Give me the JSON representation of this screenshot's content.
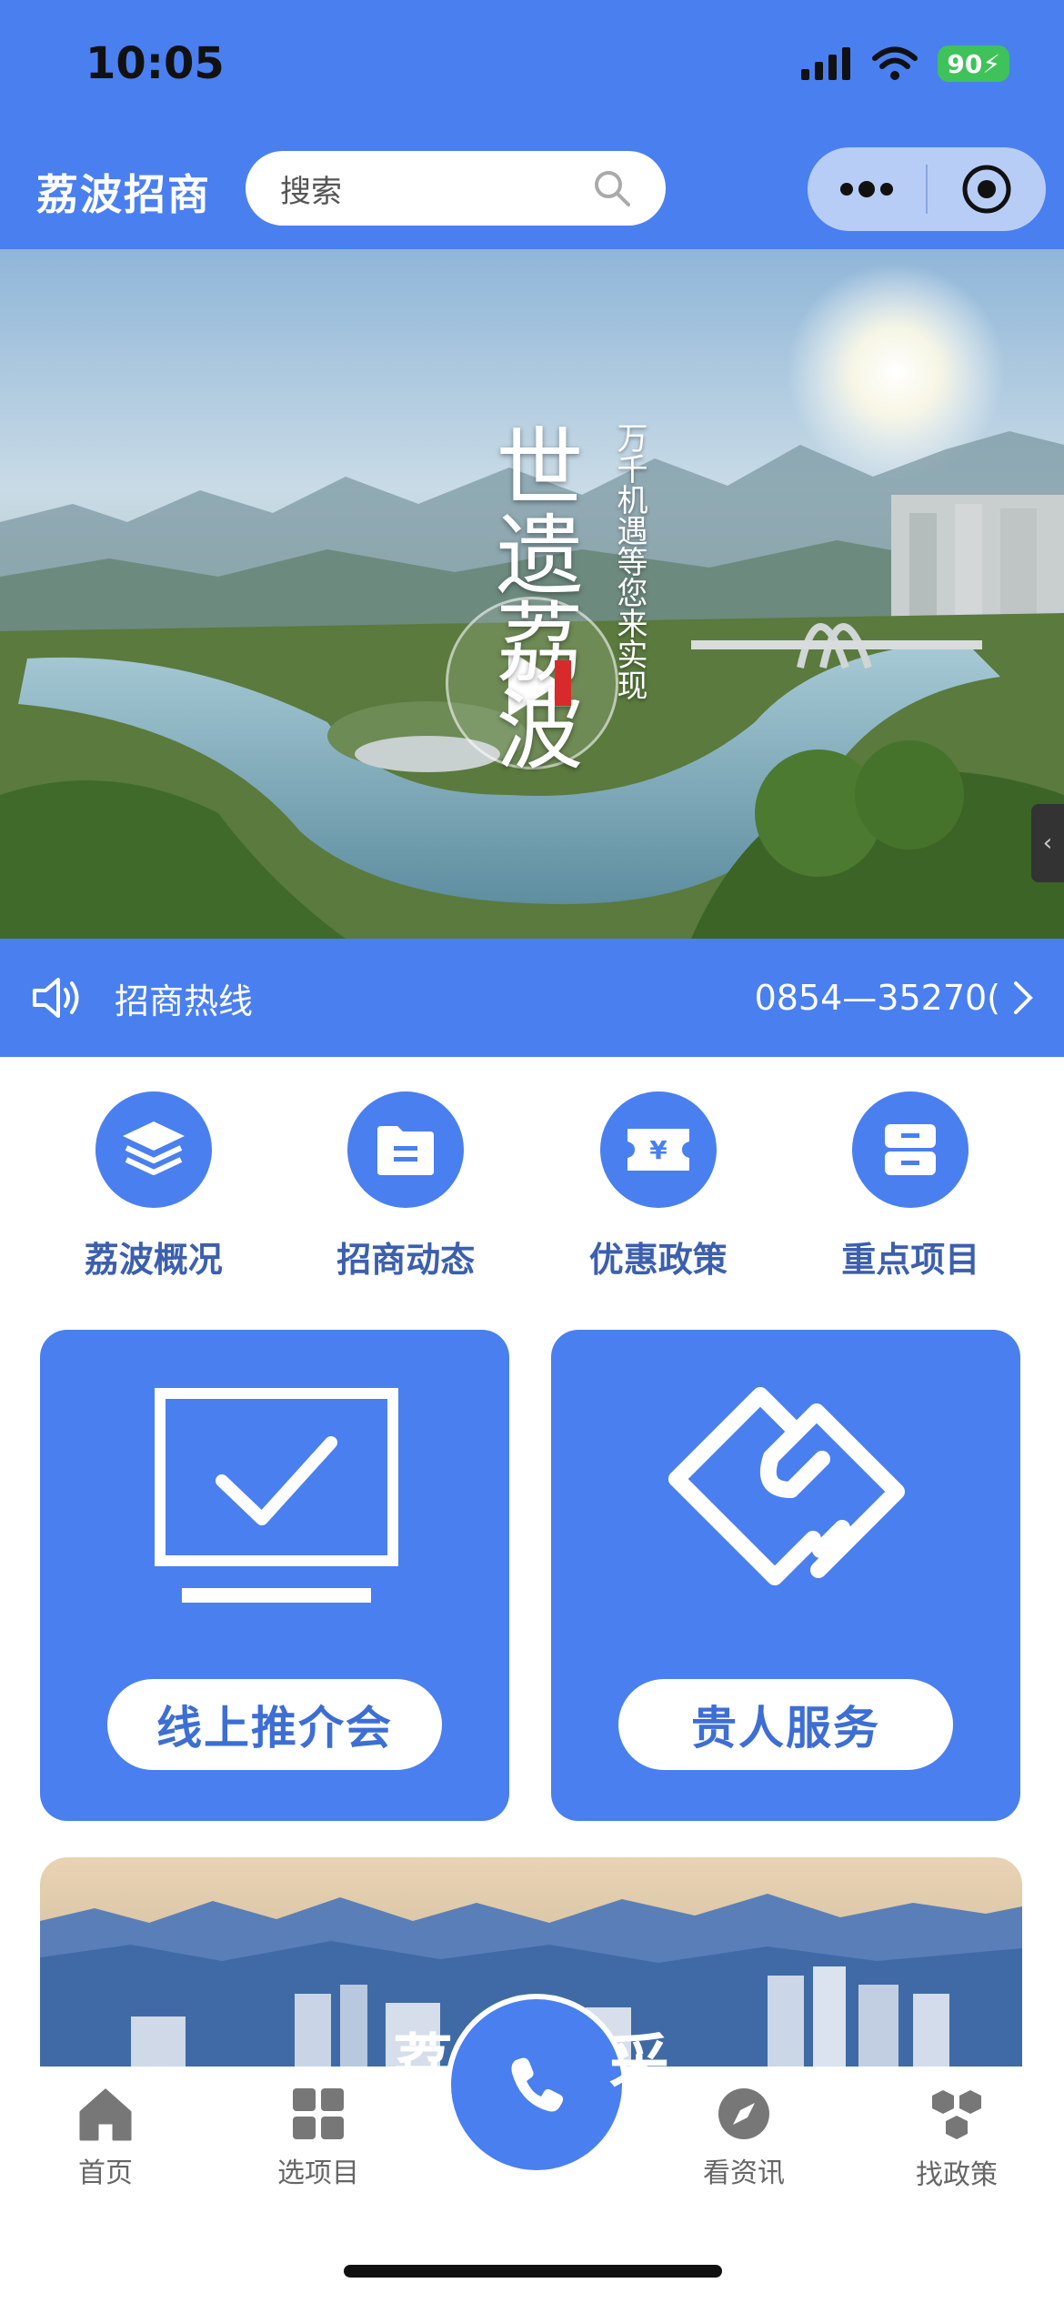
{
  "status_bar": {
    "time": "10:05",
    "battery": "90"
  },
  "header": {
    "app_name": "荔波招商",
    "search_placeholder": "搜索"
  },
  "hero": {
    "calligraphy_main": "世遗荔波",
    "calligraphy_side": "万千机遇等您来实现"
  },
  "hotline": {
    "label": "招商热线",
    "number": "0854—35270("
  },
  "quick_links": [
    {
      "label": "荔波概况",
      "icon": "layers-icon"
    },
    {
      "label": "招商动态",
      "icon": "folder-icon"
    },
    {
      "label": "优惠政策",
      "icon": "ticket-yen-icon"
    },
    {
      "label": "重点项目",
      "icon": "cabinet-icon"
    }
  ],
  "cards": [
    {
      "label": "线上推介会",
      "icon": "monitor-check-icon"
    },
    {
      "label": "贵人服务",
      "icon": "handshake-icon"
    }
  ],
  "banner": {
    "text_left": "荔",
    "text_right": "采"
  },
  "tabs": [
    {
      "label": "首页",
      "icon": "home-icon"
    },
    {
      "label": "选项目",
      "icon": "grid-icon"
    },
    {
      "label": "看资讯",
      "icon": "compass-icon"
    },
    {
      "label": "找政策",
      "icon": "cubes-icon"
    }
  ],
  "colors": {
    "primary": "#4a7ff0",
    "label_blue": "#3c5fae",
    "battery_green": "#3fc25a"
  }
}
